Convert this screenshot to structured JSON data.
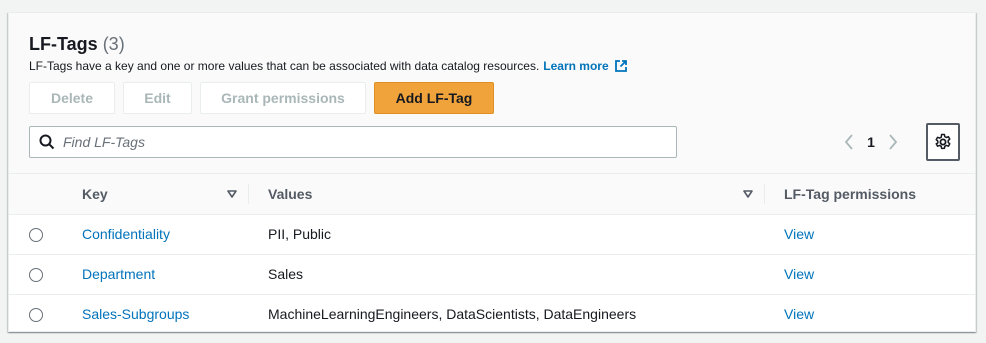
{
  "header": {
    "title": "LF-Tags",
    "count": "(3)",
    "description": "LF-Tags have a key and one or more values that can be associated with data catalog resources.",
    "learn_more": "Learn more"
  },
  "toolbar": {
    "delete_label": "Delete",
    "edit_label": "Edit",
    "grant_label": "Grant permissions",
    "add_label": "Add LF-Tag"
  },
  "search": {
    "placeholder": "Find LF-Tags",
    "value": ""
  },
  "pagination": {
    "page": "1"
  },
  "table": {
    "columns": [
      "Key",
      "Values",
      "LF-Tag permissions"
    ],
    "rows": [
      {
        "key": "Confidentiality",
        "values": "PII, Public",
        "permissions": "View"
      },
      {
        "key": "Department",
        "values": "Sales",
        "permissions": "View"
      },
      {
        "key": "Sales-Subgroups",
        "values": "MachineLearningEngineers, DataScientists, DataEngineers",
        "permissions": "View"
      }
    ]
  },
  "colors": {
    "accent_orange": "#f0a33a",
    "link_blue": "#0073bb",
    "disabled_text": "#aab7b8"
  }
}
